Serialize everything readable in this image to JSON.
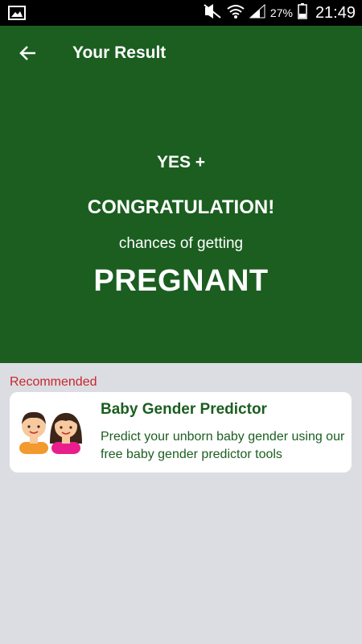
{
  "status_bar": {
    "battery_percent": "27%",
    "time": "21:49",
    "icons": [
      "image-icon",
      "mute-icon",
      "wifi-icon",
      "signal-icon",
      "battery-icon"
    ]
  },
  "app_bar": {
    "title": "Your Result",
    "back_icon": "arrow-left-icon"
  },
  "result": {
    "line1": "YES +",
    "line2": "CONGRATULATION!",
    "line3": "chances of getting",
    "line4": "PREGNANT"
  },
  "recommended": {
    "label": "Recommended",
    "card": {
      "title": "Baby Gender Predictor",
      "description": "Predict your unborn baby gender using our free baby gender predictor tools",
      "illustration": "boy-girl-icon"
    }
  },
  "colors": {
    "primary": "#1b5e20",
    "accent_red": "#c62828",
    "background": "#dcdce3"
  }
}
